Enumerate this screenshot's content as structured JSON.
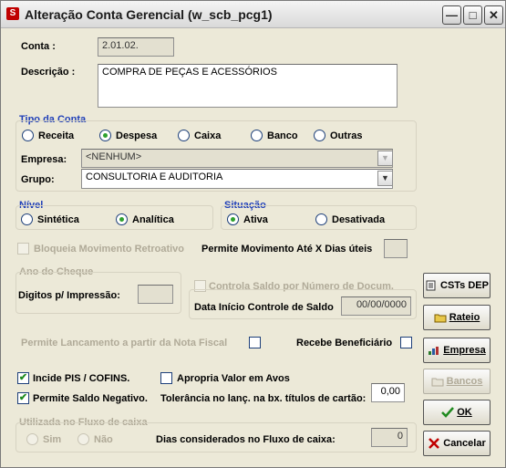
{
  "window": {
    "title": "Alteração Conta Gerencial (w_scb_pcg1)",
    "minimize_glyph": "—",
    "maximize_glyph": "□",
    "close_glyph": "✕"
  },
  "conta": {
    "label": "Conta :",
    "value": "2.01.02."
  },
  "descricao": {
    "label": "Descrição :",
    "value": "COMPRA DE PEÇAS E ACESSÓRIOS"
  },
  "tipo_conta": {
    "label": "Tipo da Conta",
    "options": [
      {
        "label": "Receita",
        "checked": false
      },
      {
        "label": "Despesa",
        "checked": true
      },
      {
        "label": "Caixa",
        "checked": false
      },
      {
        "label": "Banco",
        "checked": false
      },
      {
        "label": "Outras",
        "checked": false
      }
    ]
  },
  "empresa": {
    "label": "Empresa:",
    "value": "<NENHUM>"
  },
  "grupo": {
    "label": "Grupo:",
    "value": "CONSULTORIA E AUDITORIA"
  },
  "nivel": {
    "label": "Nível",
    "options": [
      {
        "label": "Sintética",
        "checked": false
      },
      {
        "label": "Analítica",
        "checked": true
      }
    ]
  },
  "situacao": {
    "label": "Situação",
    "options": [
      {
        "label": "Ativa",
        "checked": true
      },
      {
        "label": "Desativada",
        "checked": false
      }
    ]
  },
  "bloqueia": {
    "label": "Bloqueia Movimento Retroativo",
    "checked": false
  },
  "permite_movimento": {
    "label": "Permite Movimento Até X Dias úteis",
    "value": ""
  },
  "ano_cheque": {
    "label": "Ano do Cheque"
  },
  "digitos": {
    "label": "Digitos p/ Impressão:",
    "value": ""
  },
  "controla_saldo": {
    "label": "Controla  Saldo por Número de Docum.",
    "checked": false
  },
  "data_inicio": {
    "label": "Data Início Controle de Saldo",
    "value": "00/00/0000"
  },
  "permite_lancamento": {
    "label": "Permite Lancamento a partir da Nota Fiscal",
    "checked": false
  },
  "recebe_beneficiario": {
    "label": "Recebe Beneficiário",
    "checked": false
  },
  "incide_pis": {
    "label": "Incide PIS / COFINS.",
    "checked": true
  },
  "apropria_valor": {
    "label": "Apropria Valor em Avos",
    "checked": false
  },
  "permite_saldo_negativo": {
    "label": "Permite Saldo Negativo.",
    "checked": true
  },
  "tolerancia": {
    "label": "Tolerância no lanç. na bx. títulos de cartão:",
    "value": "0,00"
  },
  "fluxo_caixa": {
    "label": "Utilizada no Fluxo de caixa",
    "options": [
      {
        "label": "Sim",
        "checked": false
      },
      {
        "label": "Não",
        "checked": false
      }
    ]
  },
  "dias_fluxo": {
    "label": "Dias considerados no Fluxo de caixa:",
    "value": "0"
  },
  "buttons": {
    "csts": "CSTs DEP",
    "rateio": "Rateio",
    "empresa": "Empresa",
    "bancos": "Bancos",
    "ok": "OK",
    "cancelar": "Cancelar"
  },
  "colors": {
    "section_label": "#1f3fb8",
    "disabled_text": "#b0aa98",
    "window_bg": "#ece9d8",
    "check_green": "#1f8a1f"
  }
}
